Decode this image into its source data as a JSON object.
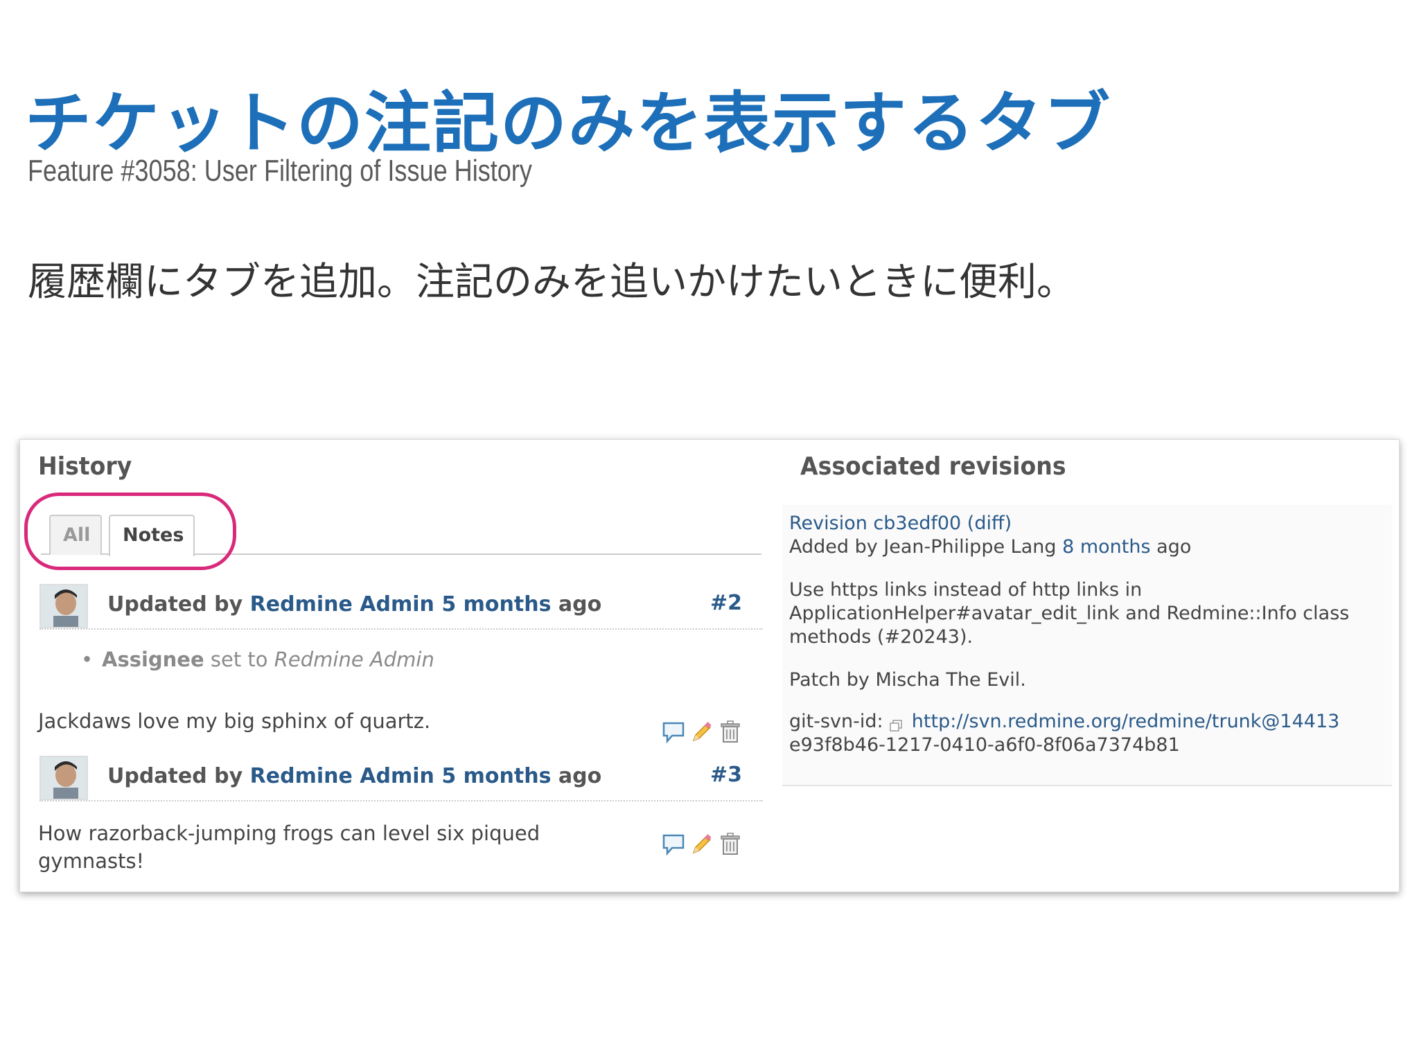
{
  "slide": {
    "title": "チケットの注記のみを表示するタブ",
    "subtitle": "Feature #3058: User Filtering of Issue History",
    "body": "履歴欄にタブを追加。注記のみを追いかけたいときに便利。"
  },
  "history": {
    "heading": "History",
    "tabs": [
      {
        "label": "All",
        "active": false
      },
      {
        "label": "Notes",
        "active": true
      }
    ],
    "journals": [
      {
        "updated_by_label": "Updated by",
        "author": "Redmine Admin",
        "time_link": "5 months",
        "time_suffix": "ago",
        "number": "#2",
        "detail_field": "Assignee",
        "detail_text": "set to",
        "detail_value": "Redmine Admin",
        "note": "Jackdaws love my big sphinx of quartz."
      },
      {
        "updated_by_label": "Updated by",
        "author": "Redmine Admin",
        "time_link": "5 months",
        "time_suffix": "ago",
        "number": "#3",
        "note_line1": "How razorback-jumping frogs can level six piqued",
        "note_line2": "gymnasts!"
      }
    ]
  },
  "revisions": {
    "heading": "Associated revisions",
    "revision_label": "Revision cb3edf00",
    "diff_link": "(diff)",
    "added_by": "Added by Jean-Philippe Lang",
    "added_time": "8 months",
    "added_suffix": "ago",
    "message_line1": "Use https links instead of http links in",
    "message_line2": "ApplicationHelper#avatar_edit_link and Redmine::Info class",
    "message_line3": "methods (#20243).",
    "patch_by": "Patch by Mischa The Evil.",
    "svn_label": "git-svn-id:",
    "svn_url": "http://svn.redmine.org/redmine/trunk@14413",
    "svn_uuid": "e93f8b46-1217-0410-a6f0-8f06a7374b81"
  },
  "colors": {
    "title": "#1c6fb8",
    "link": "#2a5a8a",
    "highlight": "#d9297a"
  }
}
